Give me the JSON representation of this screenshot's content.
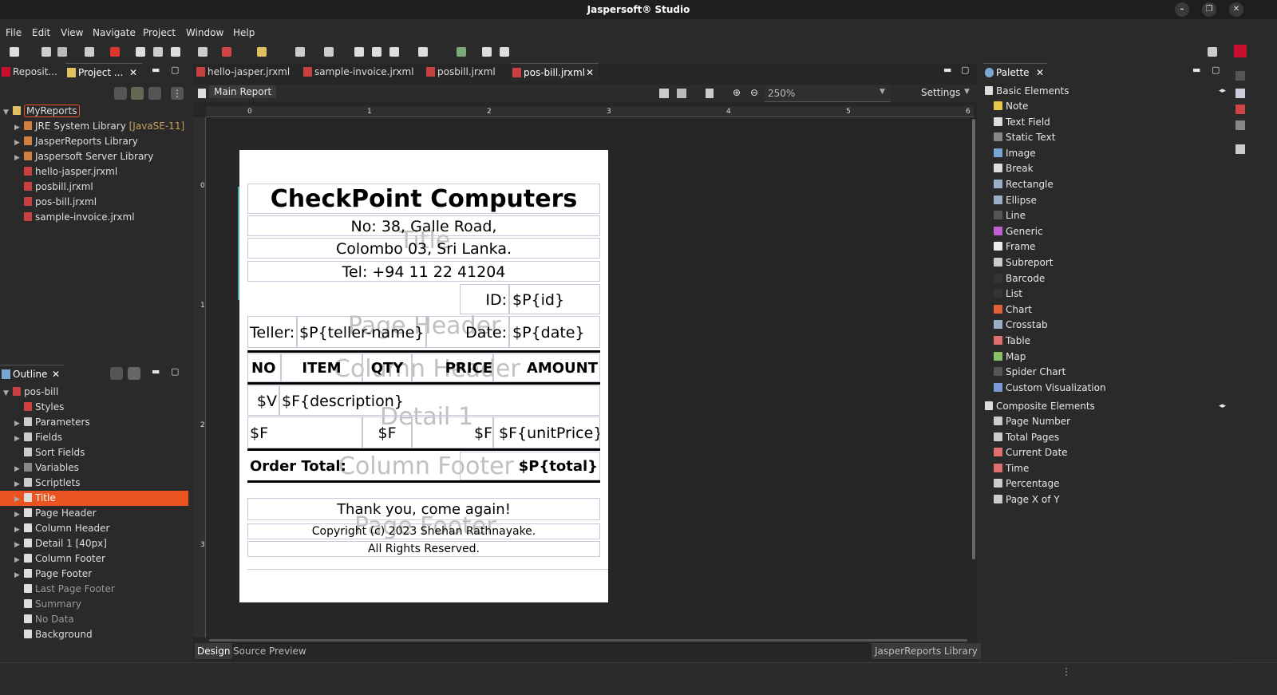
{
  "window": {
    "title": "Jaspersoft® Studio"
  },
  "menu": [
    "File",
    "Edit",
    "View",
    "Navigate",
    "Project",
    "Window",
    "Help"
  ],
  "left_tabs": {
    "repository": "Reposit...",
    "project": "Project ..."
  },
  "project_tree": [
    {
      "label": "MyReports",
      "type": "project"
    },
    {
      "label": "JRE System Library",
      "suffix": "[JavaSE-11]",
      "type": "lib"
    },
    {
      "label": "JasperReports Library",
      "type": "lib"
    },
    {
      "label": "Jaspersoft Server Library",
      "type": "lib"
    },
    {
      "label": "hello-jasper.jrxml",
      "type": "file"
    },
    {
      "label": "posbill.jrxml",
      "type": "file"
    },
    {
      "label": "pos-bill.jrxml",
      "type": "file"
    },
    {
      "label": "sample-invoice.jrxml",
      "type": "file"
    }
  ],
  "outline": {
    "tab": "Outline",
    "root": "pos-bill",
    "items": [
      "Styles",
      "Parameters",
      "Fields",
      "Sort Fields",
      "Variables",
      "Scriptlets",
      "Title",
      "Page Header",
      "Column Header",
      "Detail 1 [40px]",
      "Column Footer",
      "Page Footer",
      "Last Page Footer",
      "Summary",
      "No Data",
      "Background"
    ],
    "selected": "Title"
  },
  "editor": {
    "tabs": [
      "hello-jasper.jrxml",
      "sample-invoice.jrxml",
      "posbill.jrxml",
      "pos-bill.jrxml"
    ],
    "active_tab": "pos-bill.jrxml",
    "main_report": "Main Report",
    "zoom": "250%",
    "settings": "Settings",
    "ruler_h": [
      "0",
      "1",
      "2",
      "3",
      "4",
      "5",
      "6"
    ],
    "ruler_v": [
      "0",
      "1",
      "2",
      "3"
    ],
    "bottom_tabs": [
      "Design",
      "Source",
      "Preview"
    ],
    "library_badge": "JasperReports Library"
  },
  "report": {
    "company": "CheckPoint Computers",
    "address1": "No: 38, Galle Road,",
    "address2": "Colombo 03, Sri Lanka.",
    "tel": "Tel: +94 11 22 41204",
    "id_label": "ID:",
    "id_value": "$P{id}",
    "teller_label": "Teller:",
    "teller_value": "$P{teller-name}",
    "date_label": "Date:",
    "date_value": "$P{date}",
    "col_no": "NO",
    "col_item": "ITEM",
    "col_qty": "QTY",
    "col_price": "PRICE",
    "col_amount": "AMOUNT",
    "d_v": "$V",
    "d_desc": "$F{description}",
    "d_f1": "$F",
    "d_f2": "$F",
    "d_f3": "$F",
    "d_unit": "$F{unitPrice}.",
    "order_total": "Order Total:",
    "total_value": "$P{total}",
    "thanks": "Thank you, come again!",
    "copyright": "Copyright (c) 2023 Shehan Rathnayake.",
    "rights": "All Rights Reserved.",
    "bands": {
      "title": "Title",
      "page_header": "Page Header",
      "column_header": "Column Header",
      "detail": "Detail 1",
      "column_footer": "Column Footer",
      "page_footer": "Page Footer"
    }
  },
  "palette": {
    "tab": "Palette",
    "basic_title": "Basic Elements",
    "basic": [
      {
        "label": "Note",
        "icon": "note-icon",
        "color": "#e8c84a"
      },
      {
        "label": "Text Field",
        "icon": "textfield-icon",
        "color": "#dddddd"
      },
      {
        "label": "Static Text",
        "icon": "statictext-icon",
        "color": "#888888"
      },
      {
        "label": "Image",
        "icon": "image-icon",
        "color": "#7aa6d6"
      },
      {
        "label": "Break",
        "icon": "break-icon",
        "color": "#dddddd"
      },
      {
        "label": "Rectangle",
        "icon": "rectangle-icon",
        "color": "#9ab0c8"
      },
      {
        "label": "Ellipse",
        "icon": "ellipse-icon",
        "color": "#9ab0c8"
      },
      {
        "label": "Line",
        "icon": "line-icon",
        "color": "#555555"
      },
      {
        "label": "Generic",
        "icon": "generic-icon",
        "color": "#c060d0"
      },
      {
        "label": "Frame",
        "icon": "frame-icon",
        "color": "#eeeeee"
      },
      {
        "label": "Subreport",
        "icon": "subreport-icon",
        "color": "#cccccc"
      },
      {
        "label": "Barcode",
        "icon": "barcode-icon",
        "color": "#333333"
      },
      {
        "label": "List",
        "icon": "list-icon",
        "color": "#333333"
      },
      {
        "label": "Chart",
        "icon": "chart-icon",
        "color": "#e0603a"
      },
      {
        "label": "Crosstab",
        "icon": "crosstab-icon",
        "color": "#9ab0c8"
      },
      {
        "label": "Table",
        "icon": "table-icon",
        "color": "#e07070"
      },
      {
        "label": "Map",
        "icon": "map-icon",
        "color": "#8ac06a"
      },
      {
        "label": "Spider Chart",
        "icon": "spiderchart-icon",
        "color": "#555555"
      },
      {
        "label": "Custom Visualization",
        "icon": "customviz-icon",
        "color": "#7a9ad6"
      }
    ],
    "composite_title": "Composite Elements",
    "composite": [
      {
        "label": "Page Number",
        "icon": "pagenumber-icon",
        "color": "#cccccc"
      },
      {
        "label": "Total Pages",
        "icon": "totalpages-icon",
        "color": "#cccccc"
      },
      {
        "label": "Current Date",
        "icon": "currentdate-icon",
        "color": "#e07070"
      },
      {
        "label": "Time",
        "icon": "time-icon",
        "color": "#e07070"
      },
      {
        "label": "Percentage",
        "icon": "percentage-icon",
        "color": "#cccccc"
      },
      {
        "label": "Page X of Y",
        "icon": "pagexofy-icon",
        "color": "#cccccc"
      }
    ]
  },
  "colors": {
    "selection": "#e95420",
    "accent": "#c8102e",
    "page": "#ffffff"
  }
}
